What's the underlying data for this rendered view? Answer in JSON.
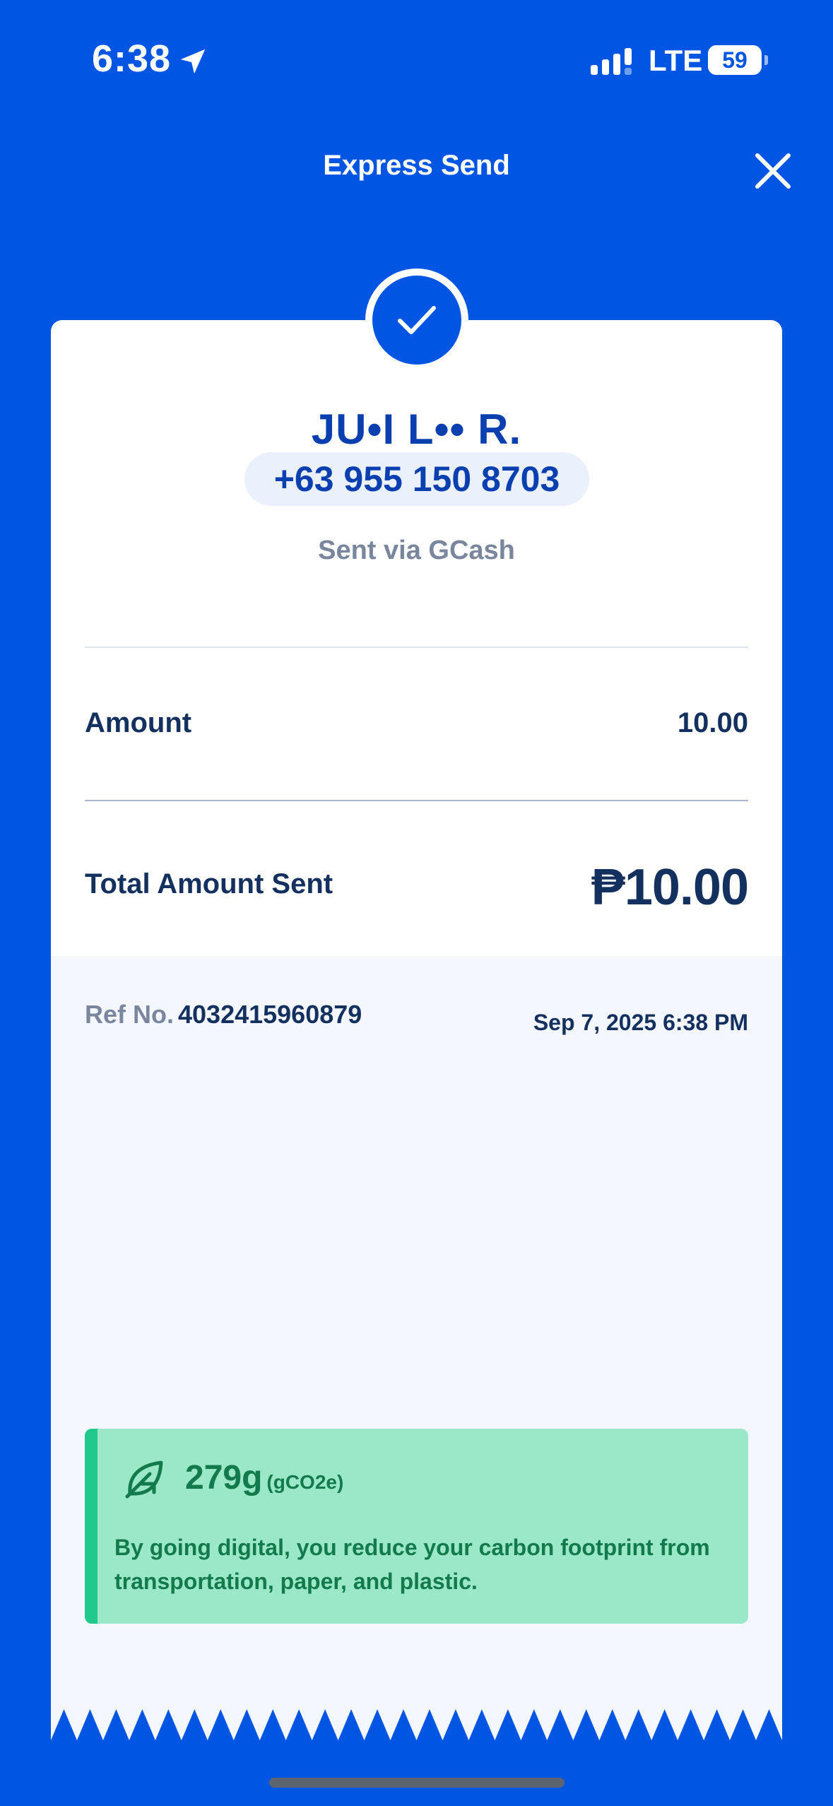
{
  "status_bar": {
    "time": "6:38",
    "network": "LTE",
    "battery_level": "59",
    "battery_fraction": 0.59
  },
  "header": {
    "title": "Express Send"
  },
  "recipient": {
    "name": "JU•I L•• R.",
    "phone": "+63 955 150 8703",
    "sent_via": "Sent via GCash"
  },
  "details": {
    "amount_label": "Amount",
    "amount_value": "10.00",
    "total_label": "Total Amount Sent",
    "total_value": "₱10.00"
  },
  "reference": {
    "label": "Ref No.",
    "number": "4032415960879",
    "datetime": "Sep 7, 2025 6:38 PM"
  },
  "carbon": {
    "amount": "279g",
    "unit": "(gCO2e)",
    "message": "By going digital, you reduce your carbon footprint from transportation, paper, and plastic."
  },
  "colors": {
    "brand_blue": "#0056E3",
    "text_navy": "#14305F",
    "carbon_green": "#9BE8C8",
    "carbon_text": "#127A4C"
  },
  "icons": {
    "location": "location-arrow-icon",
    "signal": "signal-bars-icon",
    "close": "close-icon",
    "check": "checkmark-icon",
    "leaf": "leaf-icon"
  }
}
